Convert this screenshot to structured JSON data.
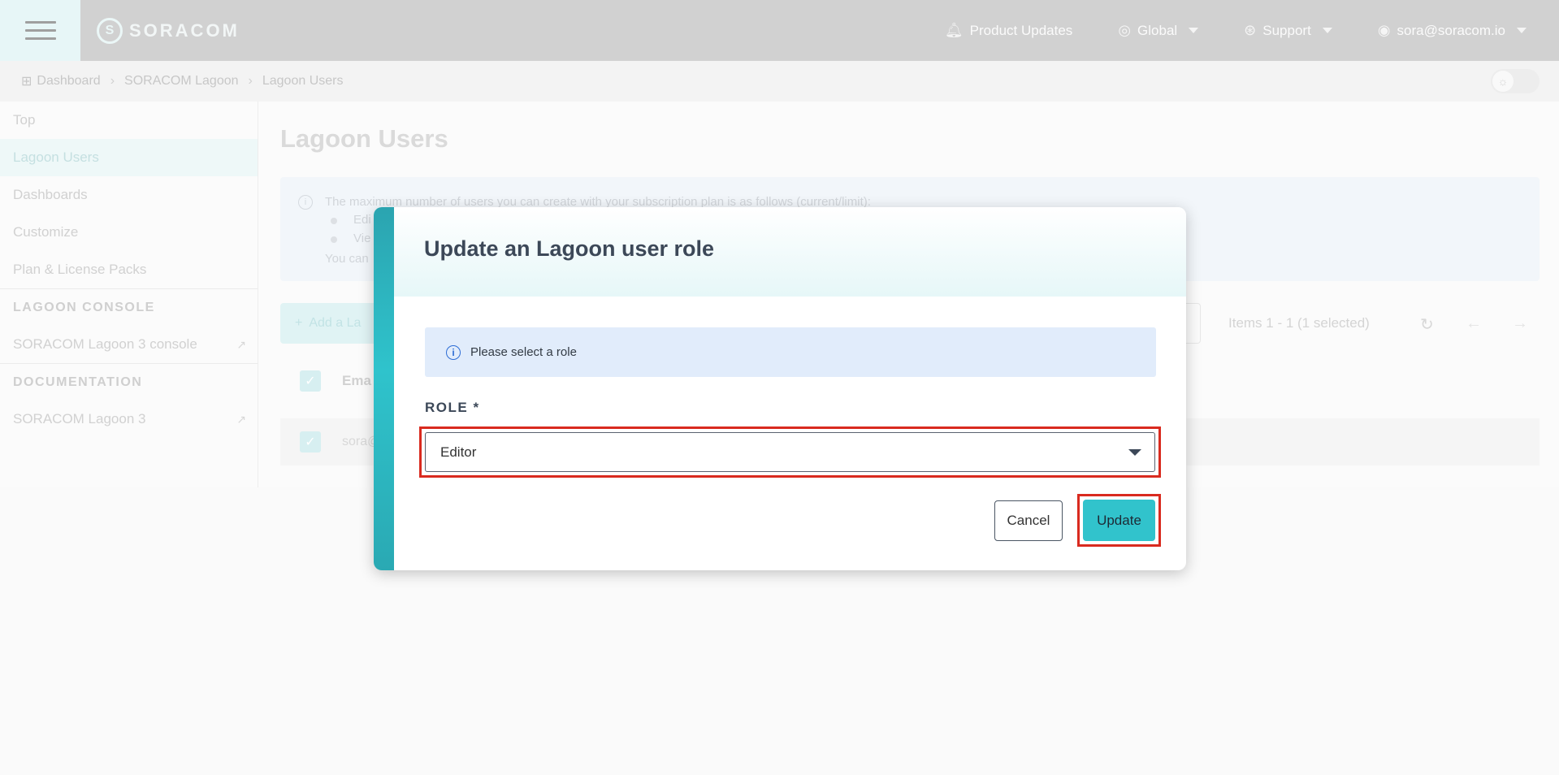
{
  "topbar": {
    "brand": "SORACOM",
    "product_updates": "Product Updates",
    "region": "Global",
    "support": "Support",
    "user_email": "sora@soracom.io"
  },
  "breadcrumb": {
    "items": [
      "Dashboard",
      "SORACOM Lagoon",
      "Lagoon Users"
    ]
  },
  "sidebar": {
    "items": [
      "Top",
      "Lagoon Users",
      "Dashboards",
      "Customize",
      "Plan & License Packs"
    ],
    "active_item": "Lagoon Users",
    "sections": [
      {
        "title": "LAGOON CONSOLE",
        "links": [
          "SORACOM Lagoon 3 console"
        ]
      },
      {
        "title": "DOCUMENTATION",
        "links": [
          "SORACOM Lagoon 3"
        ]
      }
    ]
  },
  "main": {
    "title": "Lagoon Users",
    "info_line": "The maximum number of users you can create with your subscription plan is as follows (current/limit):",
    "info_bullets": [
      "Edi",
      "Vie"
    ],
    "info_footer": "You can",
    "add_button": "Add a La",
    "items_info": "Items 1 - 1 (1 selected)",
    "table_header": "Ema",
    "table_row_email": "sora@"
  },
  "modal": {
    "title": "Update an Lagoon user role",
    "alert": "Please select a role",
    "role_label": "ROLE *",
    "role_value": "Editor",
    "cancel_label": "Cancel",
    "update_label": "Update"
  },
  "colors": {
    "accent": "#31c3cc",
    "highlight_border": "#d92a1f",
    "alert_bg": "#e1ecfb"
  }
}
